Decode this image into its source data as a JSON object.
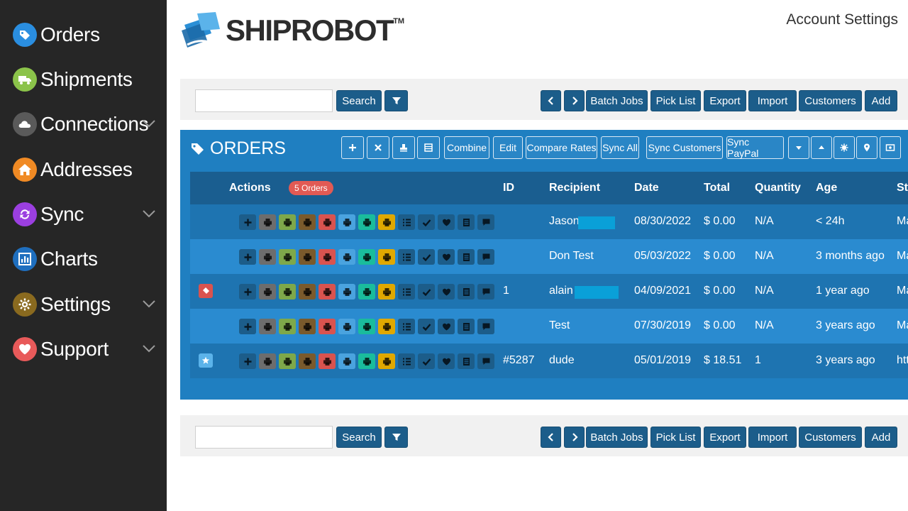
{
  "sidebar": {
    "items": [
      {
        "label": "Orders",
        "icon": "tag-icon",
        "color": "#2a8ee0",
        "has_chevron": false
      },
      {
        "label": "Shipments",
        "icon": "truck-icon",
        "color": "#8bc34a",
        "has_chevron": false
      },
      {
        "label": "Connections",
        "icon": "cloud-icon",
        "color": "#5a5a5a",
        "has_chevron": true
      },
      {
        "label": "Addresses",
        "icon": "home-icon",
        "color": "#f08a24",
        "has_chevron": false
      },
      {
        "label": "Sync",
        "icon": "sync-icon",
        "color": "#9b3fe0",
        "has_chevron": true
      },
      {
        "label": "Charts",
        "icon": "bar-chart-icon",
        "color": "#1f6fbf",
        "has_chevron": false
      },
      {
        "label": "Settings",
        "icon": "gear-icon",
        "color": "#8a6a1f",
        "has_chevron": true
      },
      {
        "label": "Support",
        "icon": "heart-icon",
        "color": "#e85a5a",
        "has_chevron": true
      }
    ]
  },
  "header": {
    "logo_text": "SHIPROBOT",
    "logo_tm": "TM",
    "account_link": "Account Settings"
  },
  "toolbar": {
    "search_placeholder": "",
    "search_label": "Search",
    "batch_jobs": "Batch Jobs",
    "pick_list": "Pick List",
    "export": "Export",
    "import": "Import",
    "customers": "Customers",
    "add": "Add"
  },
  "orders_panel": {
    "title": "ORDERS",
    "buttons": {
      "combine": "Combine",
      "edit": "Edit",
      "compare_rates": "Compare Rates",
      "sync_all": "Sync All",
      "sync_customers": "Sync Customers",
      "sync_paypal": "Sync PayPal"
    },
    "columns": {
      "actions": "Actions",
      "badge": "5 Orders",
      "id": "ID",
      "recipient": "Recipient",
      "date": "Date",
      "total": "Total",
      "quantity": "Quantity",
      "age": "Age",
      "store": "Sto"
    },
    "rows": [
      {
        "flag": "",
        "id": "",
        "recipient": "Jason",
        "date": "08/30/2022",
        "total": "$ 0.00",
        "quantity": "N/A",
        "age": "< 24h",
        "store": "Ma"
      },
      {
        "flag": "",
        "id": "",
        "recipient": "Don Test",
        "date": "05/03/2022",
        "total": "$ 0.00",
        "quantity": "N/A",
        "age": "3 months ago",
        "store": "Ma"
      },
      {
        "flag": "tag",
        "id": "1",
        "recipient": "alain",
        "date": "04/09/2021",
        "total": "$ 0.00",
        "quantity": "N/A",
        "age": "1 year ago",
        "store": "Ma"
      },
      {
        "flag": "",
        "id": "",
        "recipient": "Test",
        "date": "07/30/2019",
        "total": "$ 0.00",
        "quantity": "N/A",
        "age": "3 years ago",
        "store": "Ma"
      },
      {
        "flag": "star",
        "id": "#5287",
        "recipient": "dude",
        "date": "05/01/2019",
        "total": "$ 18.51",
        "quantity": "1",
        "age": "3 years ago",
        "store": "htt"
      }
    ],
    "action_icons": [
      {
        "name": "add-icon",
        "color": "#1c5d8a"
      },
      {
        "name": "print-icon",
        "color": "#6d6d6d"
      },
      {
        "name": "print-icon",
        "color": "#7ea84a"
      },
      {
        "name": "print-icon",
        "color": "#7a5a2c"
      },
      {
        "name": "print-icon",
        "color": "#d9534f"
      },
      {
        "name": "print-icon",
        "color": "#4aa3df"
      },
      {
        "name": "print-icon",
        "color": "#1abc9c"
      },
      {
        "name": "print-icon",
        "color": "#e0a800"
      },
      {
        "name": "list-icon",
        "color": "#1c5d8a"
      },
      {
        "name": "check-icon",
        "color": "#1c5d8a"
      },
      {
        "name": "heart-icon",
        "color": "#1c5d8a"
      },
      {
        "name": "notes-icon",
        "color": "#1c5d8a"
      },
      {
        "name": "comment-icon",
        "color": "#1c5d8a"
      }
    ]
  }
}
